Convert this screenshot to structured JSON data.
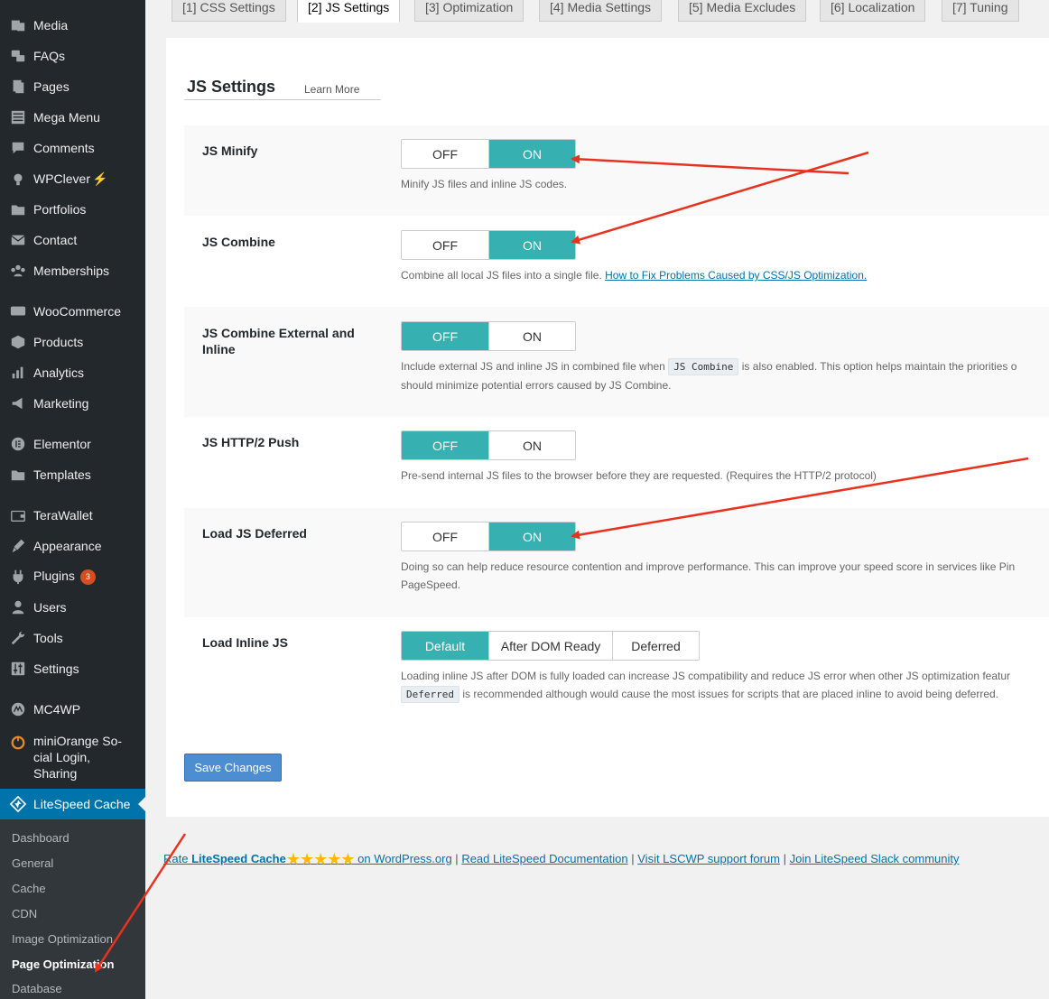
{
  "sidebar": {
    "items": [
      {
        "label": "Media",
        "icon": "media-icon"
      },
      {
        "label": "FAQs",
        "icon": "faqs-icon"
      },
      {
        "label": "Pages",
        "icon": "pages-icon"
      },
      {
        "label": "Mega Menu",
        "icon": "mega-menu-icon"
      },
      {
        "label": "Comments",
        "icon": "comments-icon"
      },
      {
        "label": "WPClever",
        "icon": "wpclever-icon"
      },
      {
        "label": "Portfolios",
        "icon": "portfolios-icon"
      },
      {
        "label": "Contact",
        "icon": "contact-icon"
      },
      {
        "label": "Memberships",
        "icon": "memberships-icon"
      },
      {
        "label": "WooCommerce",
        "icon": "woocommerce-icon"
      },
      {
        "label": "Products",
        "icon": "products-icon"
      },
      {
        "label": "Analytics",
        "icon": "analytics-icon"
      },
      {
        "label": "Marketing",
        "icon": "marketing-icon"
      },
      {
        "label": "Elementor",
        "icon": "elementor-icon"
      },
      {
        "label": "Templates",
        "icon": "templates-icon"
      },
      {
        "label": "TeraWallet",
        "icon": "terawallet-icon"
      },
      {
        "label": "Appearance",
        "icon": "appearance-icon"
      },
      {
        "label": "Plugins",
        "icon": "plugins-icon",
        "badge": "3"
      },
      {
        "label": "Users",
        "icon": "users-icon"
      },
      {
        "label": "Tools",
        "icon": "tools-icon"
      },
      {
        "label": "Settings",
        "icon": "settings-icon"
      },
      {
        "label": "MC4WP",
        "icon": "mc4wp-icon"
      },
      {
        "label": "miniOrange So-cial Login, Sharing",
        "line1": "miniOrange So-",
        "line2": "cial Login,",
        "line3": "Sharing",
        "icon": "miniorange-icon"
      },
      {
        "label": "LiteSpeed Cache",
        "icon": "litespeed-icon"
      }
    ],
    "submenu": [
      "Dashboard",
      "General",
      "Cache",
      "CDN",
      "Image Optimization",
      "Page Optimization",
      "Database"
    ]
  },
  "tabs": [
    "[1] CSS Settings",
    "[2] JS Settings",
    "[3] Optimization",
    "[4] Media Settings",
    "[5] Media Excludes",
    "[6] Localization",
    "[7] Tuning"
  ],
  "section": {
    "title": "JS Settings",
    "learn_more": "Learn More"
  },
  "toggle_labels": {
    "off": "OFF",
    "on": "ON"
  },
  "settings": [
    {
      "label": "JS Minify",
      "value": "ON",
      "desc": "Minify JS files and inline JS codes."
    },
    {
      "label": "JS Combine",
      "value": "ON",
      "desc": "Combine all local JS files into a single file.",
      "link": "How to Fix Problems Caused by CSS/JS Optimization."
    },
    {
      "label": "JS Combine External and Inline",
      "value": "OFF",
      "desc_a": "Include external JS and inline JS in combined file when",
      "desc_code": "JS Combine",
      "desc_b": "is also enabled. This option helps maintain the priorities o",
      "desc_c": "should minimize potential errors caused by JS Combine."
    },
    {
      "label": "JS HTTP/2 Push",
      "value": "OFF",
      "desc": "Pre-send internal JS files to the browser before they are requested. (Requires the HTTP/2 protocol)"
    },
    {
      "label": "Load JS Deferred",
      "value": "ON",
      "desc_a": "Doing so can help reduce resource contention and improve performance. This can improve your speed score in services like Pin",
      "desc_b": "PageSpeed."
    },
    {
      "label": "Load Inline JS",
      "options": [
        "Default",
        "After DOM Ready",
        "Deferred"
      ],
      "selected": "Default",
      "desc_a": "Loading inline JS after DOM is fully loaded can increase JS compatibility and reduce JS error when other JS optimization featur",
      "desc_code": "Deferred",
      "desc_b": "is recommended although would cause the most issues for scripts that are placed inline to avoid being deferred."
    }
  ],
  "save_label": "Save Changes",
  "footer": {
    "rate_prefix": "Rate ",
    "rate_name": "LiteSpeed Cache",
    "stars": "★★★★★",
    "rate_suffix": " on WordPress.org",
    "sep": "|",
    "docs": "Read LiteSpeed Documentation",
    "forum": "Visit LSCWP support forum",
    "slack": "Join LiteSpeed Slack community"
  },
  "colors": {
    "accent": "#36b0b0",
    "sidebar_bg": "#23282d",
    "current_menu": "#0073aa",
    "annotation_arrow": "#e8321e",
    "save_button": "#4d8ed3"
  }
}
